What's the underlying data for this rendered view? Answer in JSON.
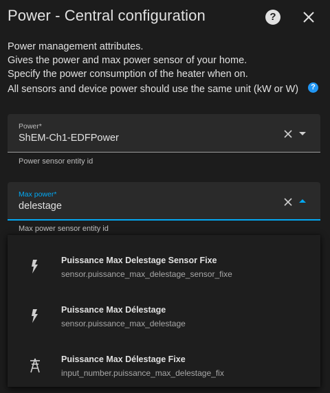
{
  "dialog": {
    "title": "Power - Central configuration",
    "help_icon": "help-circle-icon",
    "close_icon": "close-icon"
  },
  "description": {
    "line1": "Power management attributes.",
    "line2": "Gives the power and max power sensor of your home.",
    "line3": "Specify the power consumption of the heater when on.",
    "line4": "All sensors and device power should use the same unit (kW or W)",
    "info_icon": "info-icon"
  },
  "fields": {
    "power": {
      "label": "Power*",
      "value": "ShEM-Ch1-EDFPower",
      "helper": "Power sensor entity id"
    },
    "max_power": {
      "label": "Max power*",
      "value": "delestage",
      "helper": "Max power sensor entity id"
    }
  },
  "dropdown": {
    "options": [
      {
        "title": "Puissance Max Delestage Sensor Fixe",
        "entity": "sensor.puissance_max_delestage_sensor_fixe",
        "icon": "flash-icon"
      },
      {
        "title": "Puissance Max Délestage",
        "entity": "sensor.puissance_max_delestage",
        "icon": "flash-icon"
      },
      {
        "title": "Puissance Max Délestage Fixe",
        "entity": "input_number.puissance_max_delestage_fix",
        "icon": "transmission-tower-icon"
      }
    ]
  },
  "colors": {
    "background": "#1c1c1c",
    "field_background": "#2a2a2a",
    "accent": "#03a9f4",
    "info": "#2196f3"
  }
}
